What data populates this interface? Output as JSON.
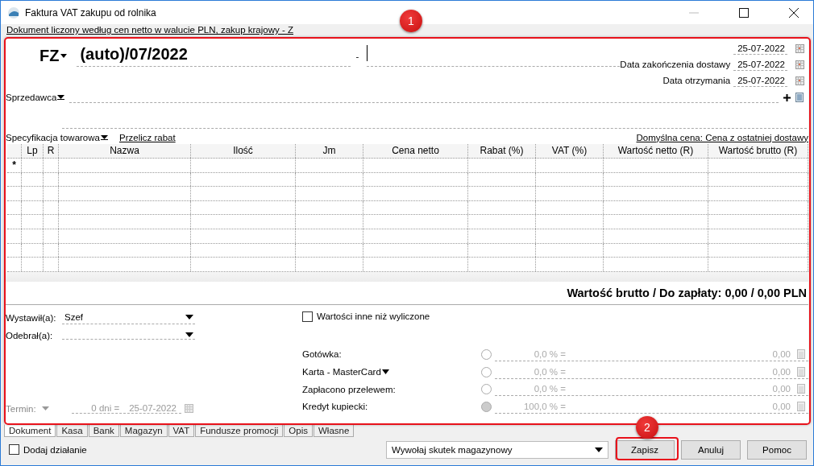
{
  "window": {
    "title": "Faktura VAT zakupu od rolnika"
  },
  "doc_info_link": "Dokument liczony według cen netto w walucie PLN, zakup krajowy - Z",
  "header": {
    "doc_type": "FZ",
    "number": "(auto)/07/2022",
    "separator": "-",
    "dates": [
      {
        "value": "25-07-2022"
      },
      {
        "label": "Data zakończenia dostawy",
        "value": "25-07-2022"
      },
      {
        "label": "Data otrzymania",
        "value": "25-07-2022"
      }
    ]
  },
  "seller": {
    "label": "Sprzedawca"
  },
  "items_section": {
    "label": "Specyfikacja towarowa",
    "recalc_link": "Przelicz rabat",
    "default_price_link": "Domyślna cena: Cena z ostatniej dostawy"
  },
  "table": {
    "columns": [
      "Lp",
      "R",
      "Nazwa",
      "Ilość",
      "Jm",
      "Cena netto",
      "Rabat (%)",
      "VAT (%)",
      "Wartość netto (R)",
      "Wartość brutto (R)"
    ],
    "new_row_marker": "*"
  },
  "total": "Wartość brutto / Do zapłaty: 0,00 / 0,00 PLN",
  "issued_by": {
    "label": "Wystawił(a):",
    "value": "Szef"
  },
  "received_by": {
    "label": "Odebrał(a):"
  },
  "other_values": {
    "label": "Wartości inne niż wyliczone",
    "checked": false
  },
  "term": {
    "label": "Termin:",
    "days": "0 dni =",
    "date": "25-07-2022",
    "disabled": true
  },
  "payments": [
    {
      "label": "Gotówka:",
      "kind": "plain",
      "selected": false,
      "percent": "0,0 % =",
      "amount": "0,00"
    },
    {
      "label": "Karta - MasterCard",
      "kind": "dropdown",
      "selected": false,
      "percent": "0,0 % =",
      "amount": "0,00"
    },
    {
      "label": "Zapłacono przelewem:",
      "kind": "plain",
      "selected": false,
      "percent": "0,0 % =",
      "amount": "0,00"
    },
    {
      "label": "Kredyt kupiecki:",
      "kind": "plain",
      "selected": true,
      "percent": "100,0 % =",
      "amount": "0,00"
    }
  ],
  "tabs": [
    {
      "label": "Dokument",
      "selected": true
    },
    {
      "label": "Kasa",
      "selected": false
    },
    {
      "label": "Bank",
      "selected": false
    },
    {
      "label": "Magazyn",
      "selected": false
    },
    {
      "label": "VAT",
      "selected": false
    },
    {
      "label": "Fundusze promocji",
      "selected": false
    },
    {
      "label": "Opis",
      "selected": false
    },
    {
      "label": "Własne",
      "selected": false
    }
  ],
  "add_action": {
    "label": "Dodaj działanie",
    "checked": false
  },
  "warehouse_effect": {
    "value": "Wywołaj skutek magazynowy"
  },
  "buttons": [
    "Zapisz",
    "Anuluj",
    "Pomoc"
  ],
  "annotations": [
    {
      "label": "1"
    },
    {
      "label": "2"
    }
  ]
}
